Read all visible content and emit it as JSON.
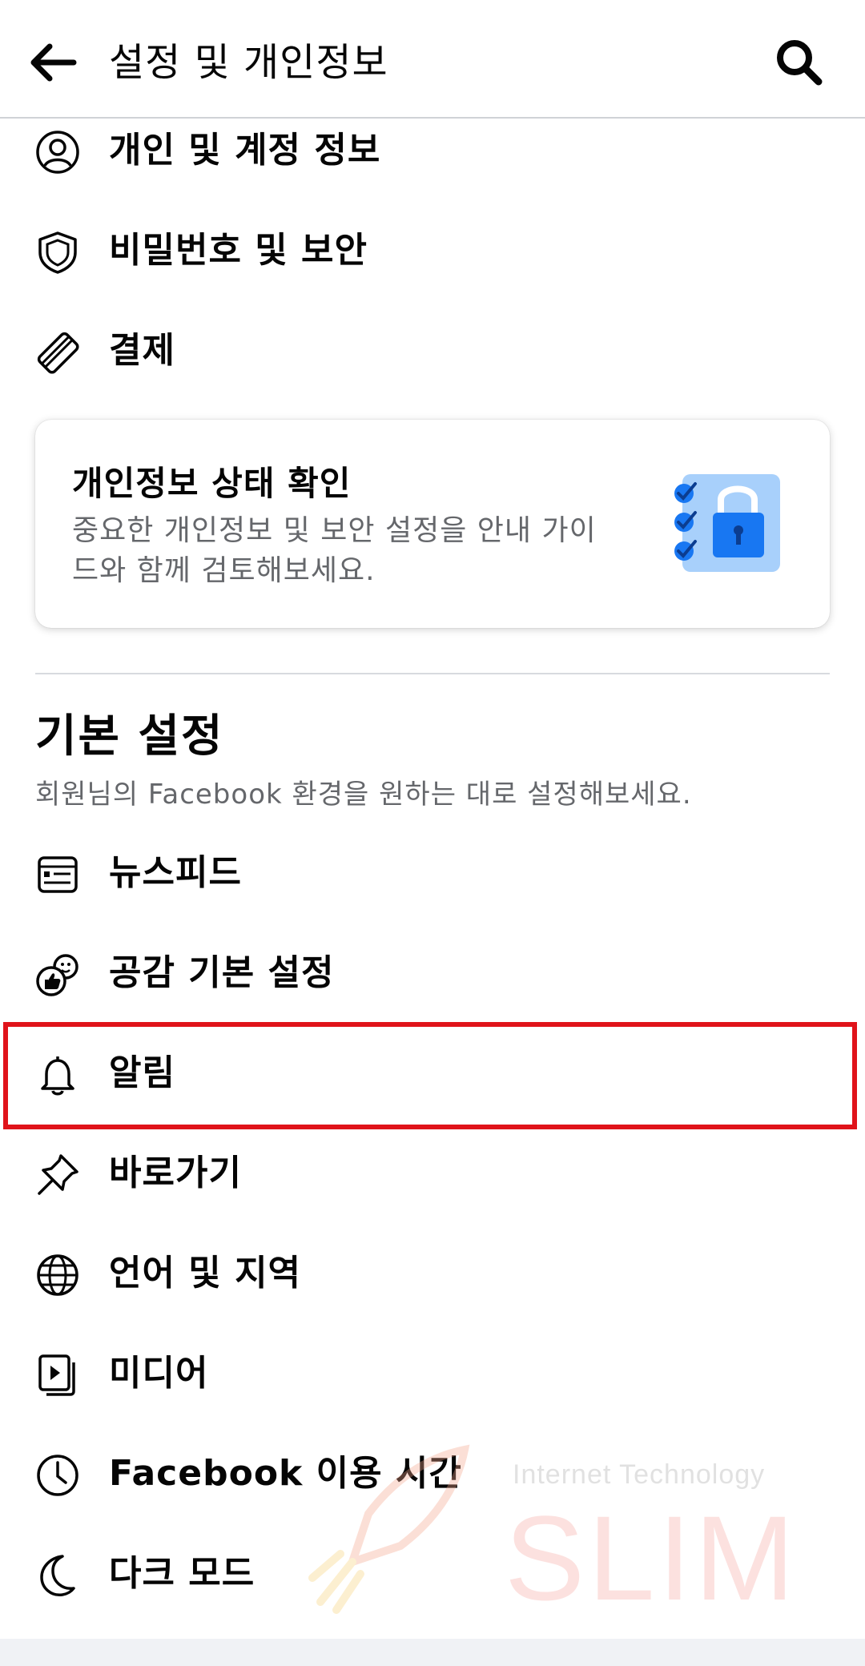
{
  "header": {
    "title": "설정 및 개인정보",
    "back_icon": "arrow-left-icon",
    "search_icon": "search-icon"
  },
  "account_items": [
    {
      "label": "개인 및 계정 정보",
      "icon": "person-circle-icon"
    },
    {
      "label": "비밀번호 및 보안",
      "icon": "shield-icon"
    },
    {
      "label": "결제",
      "icon": "credit-card-icon"
    }
  ],
  "privacy_checkup": {
    "title": "개인정보 상태 확인",
    "description": "중요한 개인정보 및 보안 설정을 안내 가이드와 함께 검토해보세요.",
    "illustration": "checklist-lock-icon"
  },
  "preferences": {
    "title": "기본 설정",
    "subtitle": "회원님의 Facebook 환경을 원하는 대로 설정해보세요.",
    "items": [
      {
        "label": "뉴스피드",
        "icon": "news-feed-icon"
      },
      {
        "label": "공감 기본 설정",
        "icon": "reactions-icon"
      },
      {
        "label": "알림",
        "icon": "bell-icon"
      },
      {
        "label": "바로가기",
        "icon": "pin-icon"
      },
      {
        "label": "언어 및 지역",
        "icon": "globe-icon"
      },
      {
        "label": "미디어",
        "icon": "media-icon"
      },
      {
        "label": "Facebook 이용 시간",
        "icon": "clock-icon"
      },
      {
        "label": "다크 모드",
        "icon": "moon-icon"
      }
    ]
  },
  "highlight": {
    "target": "알림",
    "color": "#e0131a"
  },
  "watermark": {
    "subtitle": "Internet Technology",
    "brand": "SLIM"
  },
  "colors": {
    "accent_blue": "#1877f2",
    "secondary_text": "#65676b",
    "divider": "#d8dadf"
  }
}
